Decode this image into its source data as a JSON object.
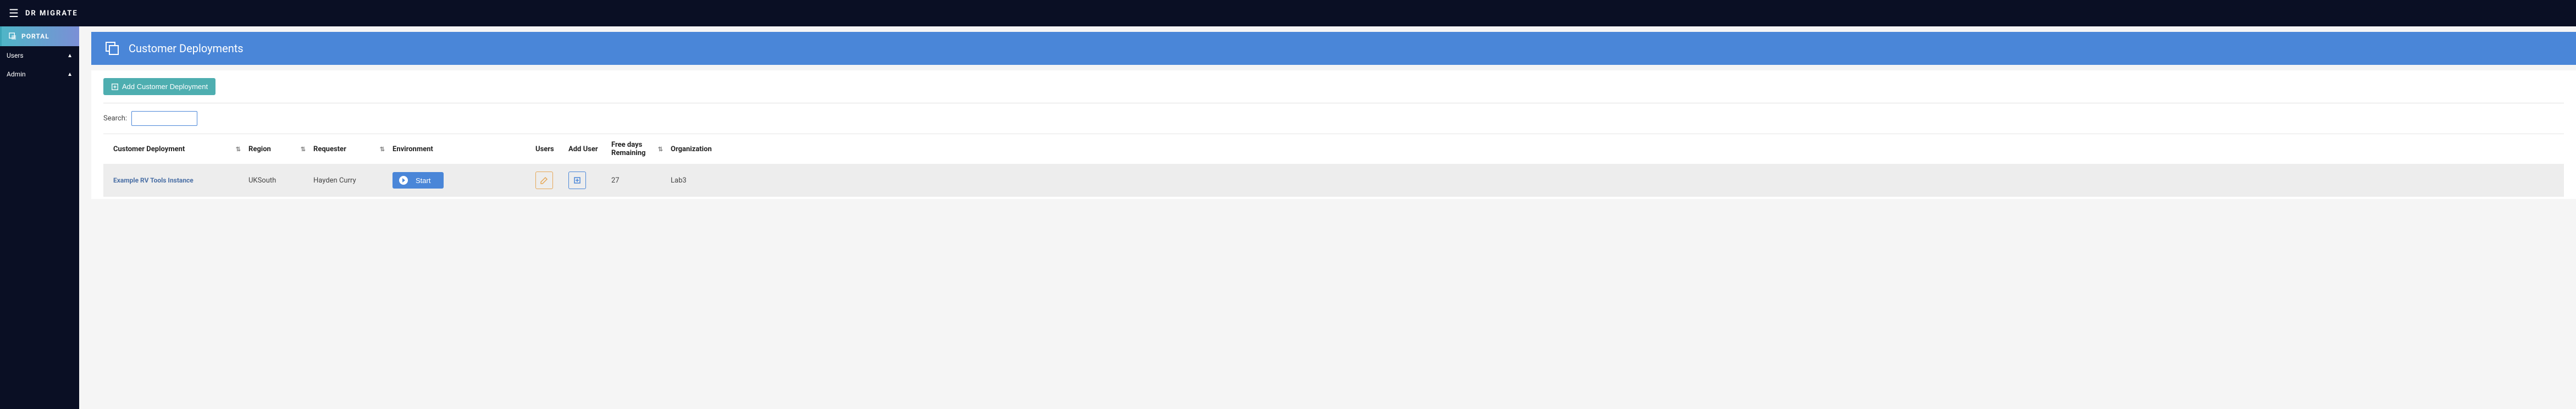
{
  "brand": "DR MIGRATE",
  "sidebar": {
    "portal_label": "PORTAL",
    "items": [
      {
        "label": "Users"
      },
      {
        "label": "Admin"
      }
    ]
  },
  "page": {
    "title": "Customer Deployments"
  },
  "actions": {
    "add_deployment": "Add Customer Deployment"
  },
  "search": {
    "label": "Search:",
    "value": ""
  },
  "table": {
    "headers": {
      "name": "Customer Deployment",
      "region": "Region",
      "requester": "Requester",
      "environment": "Environment",
      "users": "Users",
      "add_user": "Add User",
      "free_days": "Free days Remaining",
      "organization": "Organization"
    },
    "rows": [
      {
        "name": "Example RV Tools Instance",
        "region": "UKSouth",
        "requester": "Hayden Curry",
        "environment_action": "Start",
        "free_days": "27",
        "organization": "Lab3"
      }
    ]
  }
}
